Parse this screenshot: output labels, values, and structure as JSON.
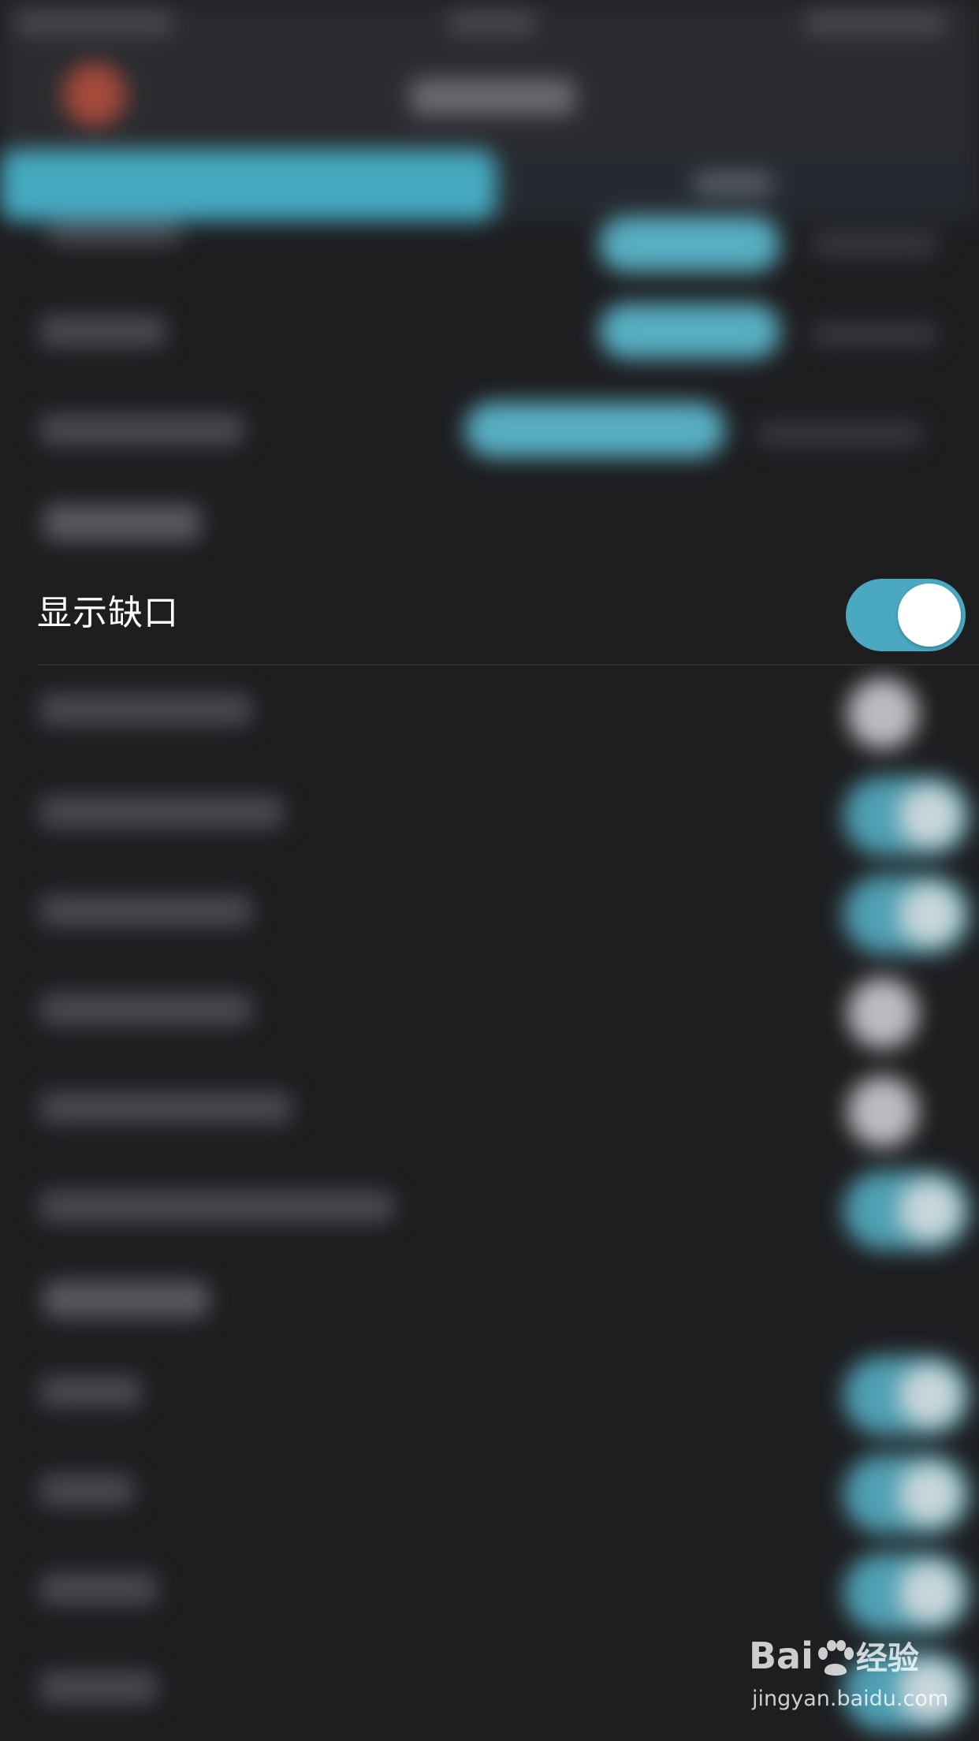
{
  "focused_setting": {
    "label": "显示缺口",
    "toggle_state": "on",
    "toggle_color": "#4aa8c0"
  },
  "watermark": {
    "logo_prefix": "Bai",
    "logo_suffix": "经验",
    "url": "jingyan.baidu.com"
  },
  "icons": {
    "back": "back-icon",
    "paw": "baidu-paw-icon"
  }
}
